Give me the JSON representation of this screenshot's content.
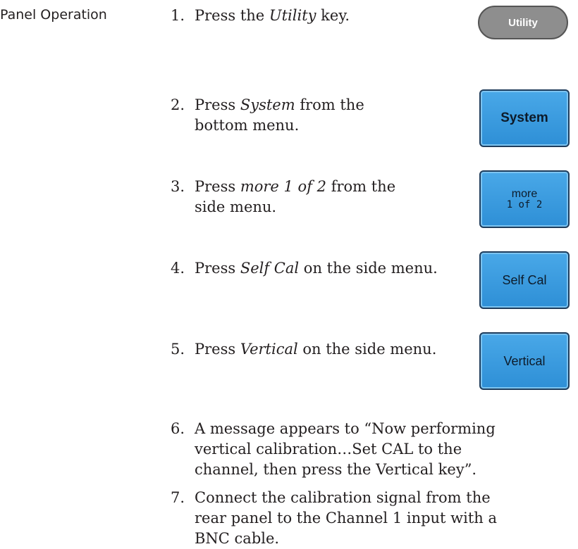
{
  "section_label": "Panel Operation",
  "steps": [
    {
      "num": "1.",
      "pre": "Press the ",
      "em": "Utility",
      "post": " key."
    },
    {
      "num": "2.",
      "pre": "Press ",
      "em": "System",
      "post": " from the bottom menu."
    },
    {
      "num": "3.",
      "pre": "Press ",
      "em": "more 1 of 2",
      "post": " from the side menu."
    },
    {
      "num": "4.",
      "pre": "Press ",
      "em": "Self Cal",
      "post": " on the side menu."
    },
    {
      "num": "5.",
      "pre": "Press ",
      "em": "Vertical",
      "post": " on the side menu."
    },
    {
      "num": "6.",
      "text": "A message appears to “Now performing vertical calibration…Set CAL to the channel, then press the Vertical key”."
    },
    {
      "num": "7.",
      "text": "Connect the calibration signal from the rear panel to the Channel 1 input with a BNC cable."
    }
  ],
  "keys": {
    "utility": "Utility",
    "system": "System",
    "more_line1": "more",
    "more_line2": "1 of 2",
    "self_cal": "Self Cal",
    "vertical": "Vertical"
  }
}
